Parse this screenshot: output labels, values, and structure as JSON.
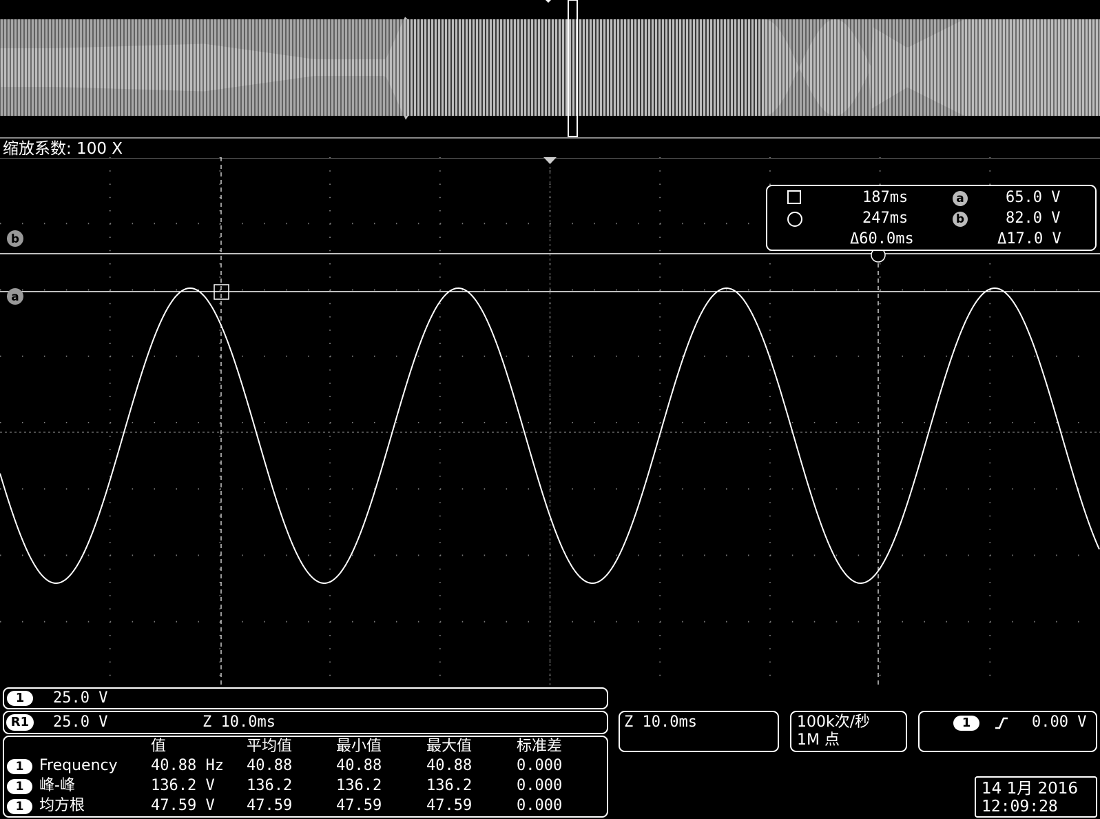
{
  "overview": {
    "zoom_label": "缩放系数: 100 X"
  },
  "cursors": {
    "a_marker": "a",
    "b_marker": "b",
    "readout": {
      "t1": "187ms",
      "t2": "247ms",
      "dt": "Δ60.0ms",
      "va": "65.0 V",
      "vb": "82.0 V",
      "dv": "Δ17.0 V",
      "a_label": "a",
      "b_label": "b"
    }
  },
  "channel1": {
    "badge": "1",
    "scale": "25.0 V"
  },
  "ref1": {
    "badge": "R1",
    "scale": "25.0 V",
    "zoom_time": "Z 10.0ms"
  },
  "timebase": {
    "zoom_time": "Z 10.0ms"
  },
  "acquisition": {
    "rate": "100k次/秒",
    "points": "1M 点"
  },
  "trigger": {
    "badge": "1",
    "slope_icon": "rising-edge-icon",
    "level": "0.00 V"
  },
  "measurements": {
    "headers": [
      "值",
      "平均值",
      "最小值",
      "最大值",
      "标准差"
    ],
    "rows": [
      {
        "ch": "1",
        "name": "Frequency",
        "value": "40.88 Hz",
        "mean": "40.88",
        "min": "40.88",
        "max": "40.88",
        "std": "0.000"
      },
      {
        "ch": "1",
        "name": "峰-峰",
        "value": "136.2 V",
        "mean": "136.2",
        "min": "136.2",
        "max": "136.2",
        "std": "0.000"
      },
      {
        "ch": "1",
        "name": "均方根",
        "value": "47.59 V",
        "mean": "47.59",
        "min": "47.59",
        "max": "47.59",
        "std": "0.000"
      }
    ]
  },
  "datetime": {
    "date": "14 1月 2016",
    "time": "12:09:28"
  }
}
